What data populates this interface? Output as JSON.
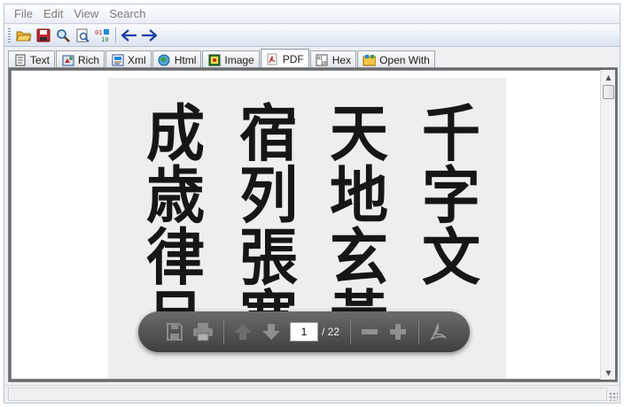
{
  "menu": {
    "file": "File",
    "edit": "Edit",
    "view": "View",
    "search": "Search"
  },
  "toolbar": {
    "icons": [
      "open-folder-icon",
      "save-icon",
      "search-icon",
      "document-properties-icon",
      "hex-code-icon",
      "back-arrow-icon",
      "forward-arrow-icon"
    ]
  },
  "tabs": [
    {
      "label": "Text",
      "icon": "text-document-icon"
    },
    {
      "label": "Rich",
      "icon": "rich-text-icon"
    },
    {
      "label": "Xml",
      "icon": "xml-icon"
    },
    {
      "label": "Html",
      "icon": "html-globe-icon"
    },
    {
      "label": "Image",
      "icon": "image-icon"
    },
    {
      "label": "PDF",
      "icon": "pdf-icon",
      "active": true
    },
    {
      "label": "Hex",
      "icon": "hex-binary-icon"
    },
    {
      "label": "Open With",
      "icon": "open-with-icon"
    }
  ],
  "document": {
    "columns": [
      [
        "千",
        "字",
        "文"
      ],
      [
        "天",
        "地",
        "玄",
        "黃"
      ],
      [
        "宿",
        "列",
        "張",
        "寒"
      ],
      [
        "成",
        "歳",
        "律",
        "呂"
      ]
    ]
  },
  "pdf_toolbar": {
    "current_page": "1",
    "total_pages": "/ 22"
  },
  "colors": {
    "accent": "#c62828",
    "toolbar_bg": "#dbe4f1",
    "pdfbar_bg": "#4a4a4a"
  }
}
